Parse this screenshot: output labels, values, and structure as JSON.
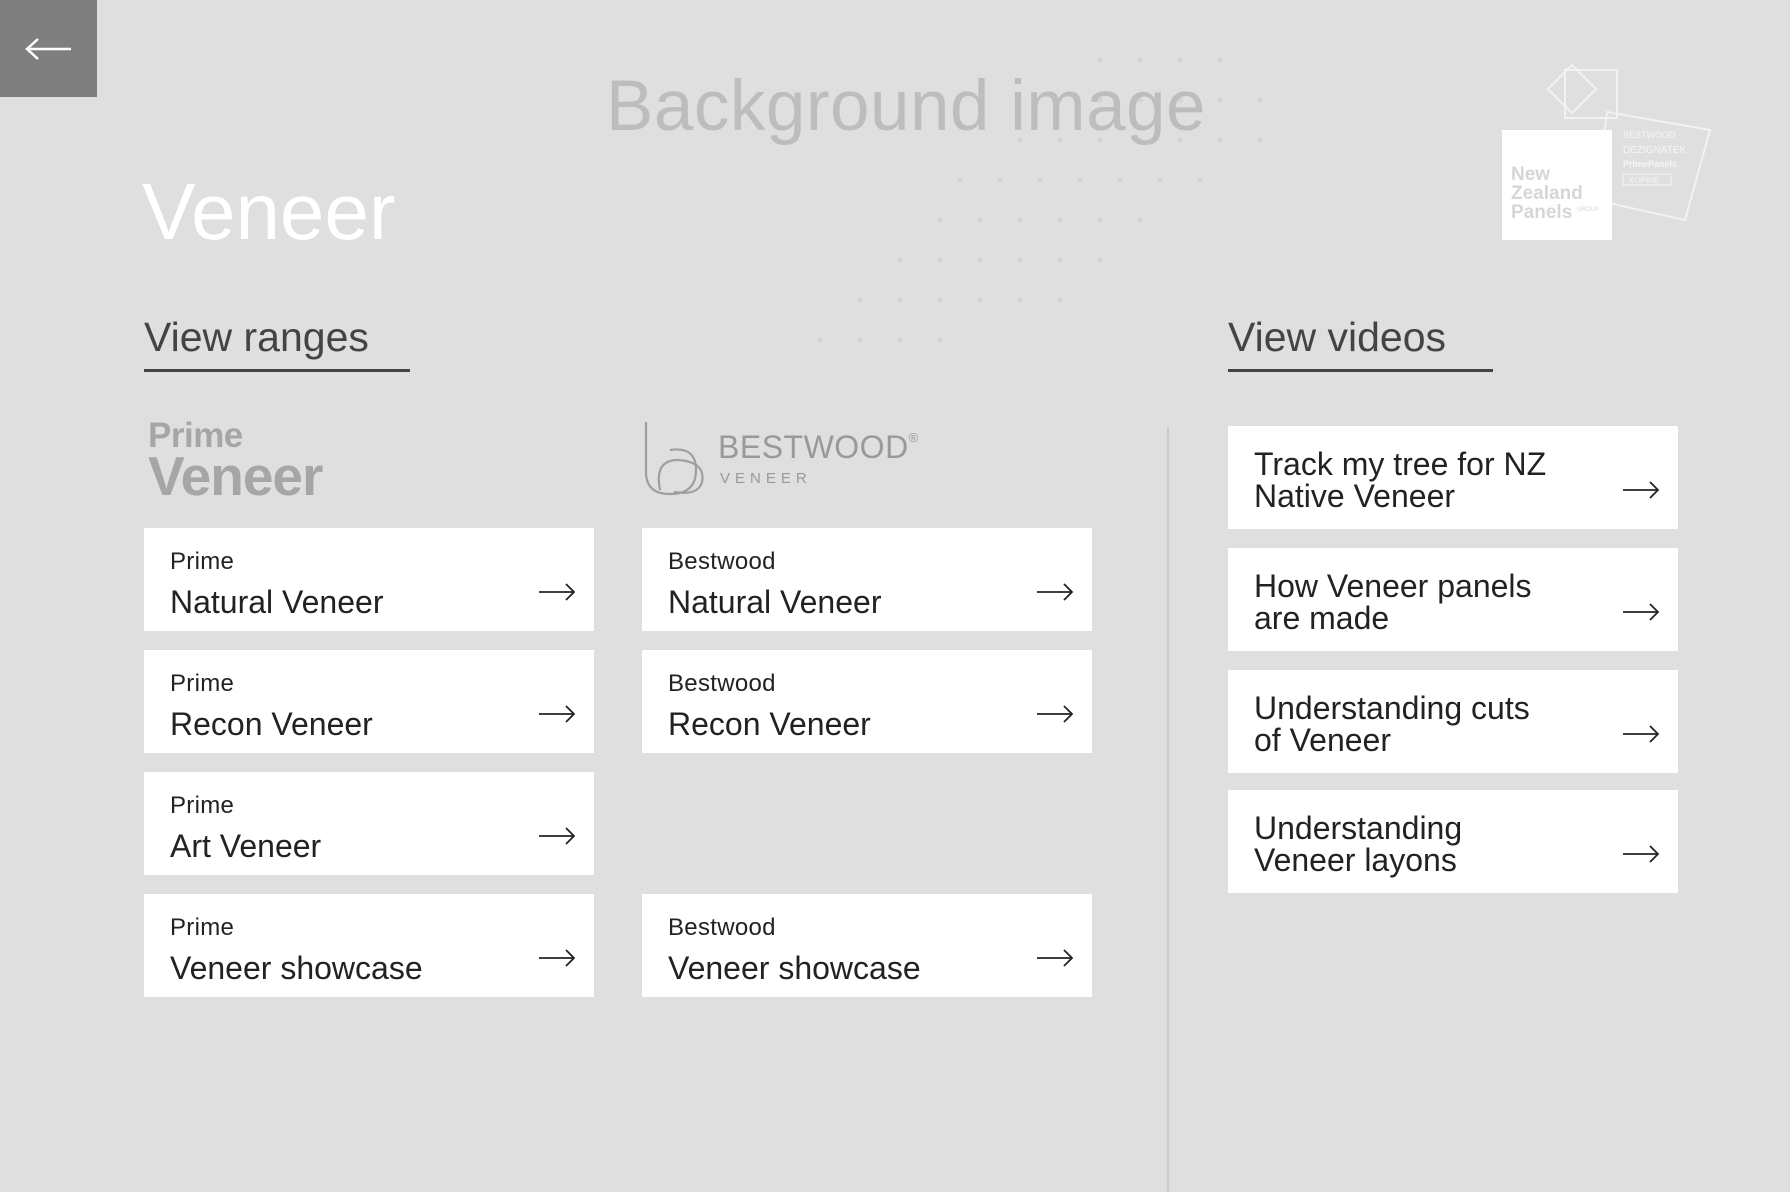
{
  "header": {
    "background_label": "Background image",
    "title": "Veneer"
  },
  "logo": {
    "nz_panels": "New Zealand Panels",
    "group": "GROUP",
    "brand_list": [
      "BESTWOOD",
      "DEZIGNATEK",
      "PrimePanels",
      "KOPINE"
    ]
  },
  "ranges": {
    "heading": "View ranges",
    "prime_brand": {
      "line1": "Prime",
      "line2": "Veneer"
    },
    "bestwood_brand": {
      "line1": "BESTWOOD",
      "reg": "®",
      "line2": "VENEER"
    },
    "prime_items": [
      {
        "pre": "Prime",
        "main": "Natural Veneer"
      },
      {
        "pre": "Prime",
        "main": "Recon Veneer"
      },
      {
        "pre": "Prime",
        "main": "Art Veneer"
      },
      {
        "pre": "Prime",
        "main": "Veneer showcase"
      }
    ],
    "bestwood_items": [
      {
        "pre": "Bestwood",
        "main": "Natural Veneer"
      },
      {
        "pre": "Bestwood",
        "main": "Recon Veneer"
      },
      {
        "pre": "Bestwood",
        "main": "Veneer showcase"
      }
    ]
  },
  "videos": {
    "heading": "View videos",
    "items": [
      {
        "line1": "Track my tree for NZ",
        "line2": "Native Veneer"
      },
      {
        "line1": "How Veneer panels",
        "line2": "are made"
      },
      {
        "line1": "Understanding cuts",
        "line2": "of Veneer"
      },
      {
        "line1": "Understanding",
        "line2": "Veneer layons"
      }
    ]
  },
  "icons": {
    "back": "arrow-left-icon",
    "card_arrow": "arrow-right-icon"
  },
  "colors": {
    "background": "#dfdfdf",
    "back_button": "#7f7f7f",
    "card": "#ffffff",
    "text_dark": "#222222"
  }
}
